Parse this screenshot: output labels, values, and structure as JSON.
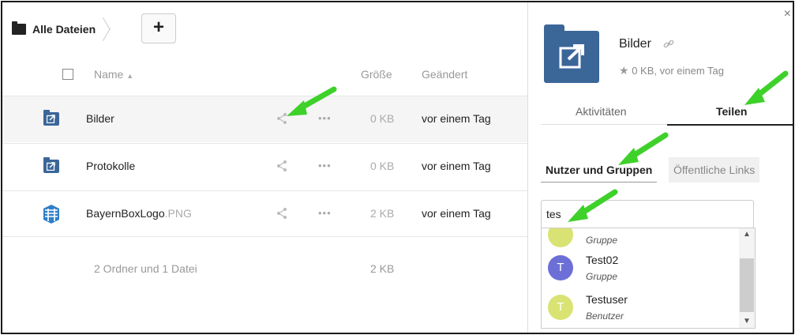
{
  "breadcrumb": {
    "root_label": "Alle Dateien"
  },
  "toolbar": {
    "add_label": "+"
  },
  "table": {
    "col_name": "Name",
    "sort_indicator": "▲",
    "col_size": "Größe",
    "col_modified": "Geändert",
    "rows": [
      {
        "name": "Bilder",
        "ext": "",
        "size": "0 KB",
        "modified": "vor einem Tag",
        "dots": "•••"
      },
      {
        "name": "Protokolle",
        "ext": "",
        "size": "0 KB",
        "modified": "vor einem Tag",
        "dots": "•••"
      },
      {
        "name": "BayernBoxLogo",
        "ext": ".PNG",
        "size": "2 KB",
        "modified": "vor einem Tag",
        "dots": "•••"
      }
    ],
    "summary": {
      "label": "2 Ordner und 1 Datei",
      "size": "2 KB"
    }
  },
  "sidebar": {
    "close": "×",
    "title": "Bilder",
    "meta": "0 KB, vor einem Tag",
    "tabs": [
      "Aktivitäten",
      "Teilen"
    ],
    "subtabs": [
      "Nutzer und Gruppen",
      "Öffentliche Links"
    ],
    "search_value": "tes",
    "options": [
      {
        "initial": "",
        "name": "",
        "type": "Gruppe",
        "color": "#d9e373"
      },
      {
        "initial": "T",
        "name": "Test02",
        "type": "Gruppe",
        "color": "#6b6fd6"
      },
      {
        "initial": "T",
        "name": "Testuser",
        "type": "Benutzer",
        "color": "#d9e373"
      }
    ]
  },
  "colors": {
    "folder": "#3b6698",
    "arrow": "#3ed12a"
  }
}
